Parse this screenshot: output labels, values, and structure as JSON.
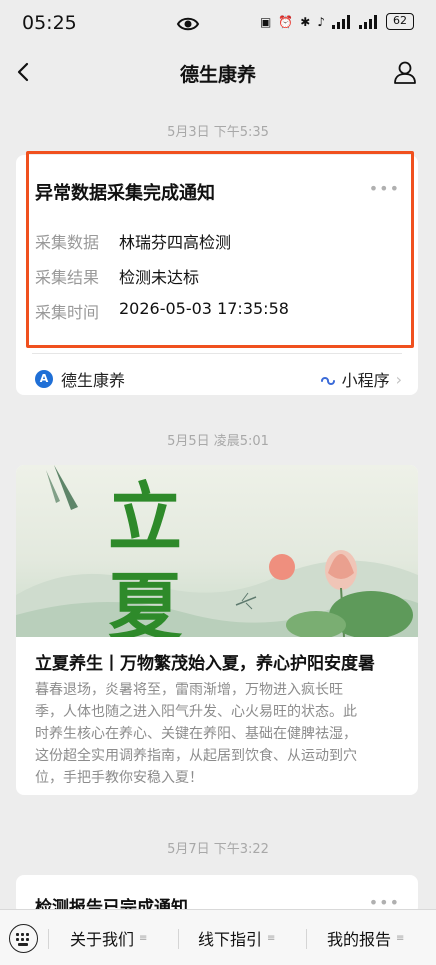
{
  "status_bar": {
    "time": "05:25",
    "battery": "62",
    "icons": [
      "nfc-icon",
      "alarm-icon",
      "bluetooth-icon",
      "mute-icon",
      "signal-icon",
      "signal-icon"
    ]
  },
  "nav": {
    "title": "德生康养"
  },
  "messages": [
    {
      "timestamp": "5月3日 下午5:35",
      "title": "异常数据采集完成通知",
      "fields": [
        {
          "label": "采集数据",
          "value": "林瑞芬四高检测"
        },
        {
          "label": "采集结果",
          "value": "检测未达标"
        },
        {
          "label": "采集时间",
          "value": "2026-05-03 17:35:58"
        }
      ],
      "source": "德生康养",
      "link_label": "小程序",
      "highlight_color": "#f0501e"
    },
    {
      "timestamp": "5月5日 凌晨5:01",
      "banner_text": "立夏",
      "title": "立夏养生丨万物繁茂始入夏，养心护阳安度暑",
      "body_lines": [
        "暮春退场，炎暑将至，雷雨渐增，万物进入疯长旺",
        "季，人体也随之进入阳气升发、心火易旺的状态。此",
        "时养生核心在养心、关键在养阳、基础在健脾祛湿，",
        "这份超全实用调养指南，从起居到饮食、从运动到穴",
        "位，手把手教你安稳入夏！"
      ]
    },
    {
      "timestamp": "5月7日 下午3:22",
      "title": "检测报告已完成通知"
    }
  ],
  "tab_bar": {
    "tabs": [
      "关于我们",
      "线下指引",
      "我的报告"
    ]
  },
  "colors": {
    "background": "#ededed",
    "card": "#ffffff",
    "banner_green": "#2e8a2a",
    "lotus_pink": "#ee8a7a"
  }
}
